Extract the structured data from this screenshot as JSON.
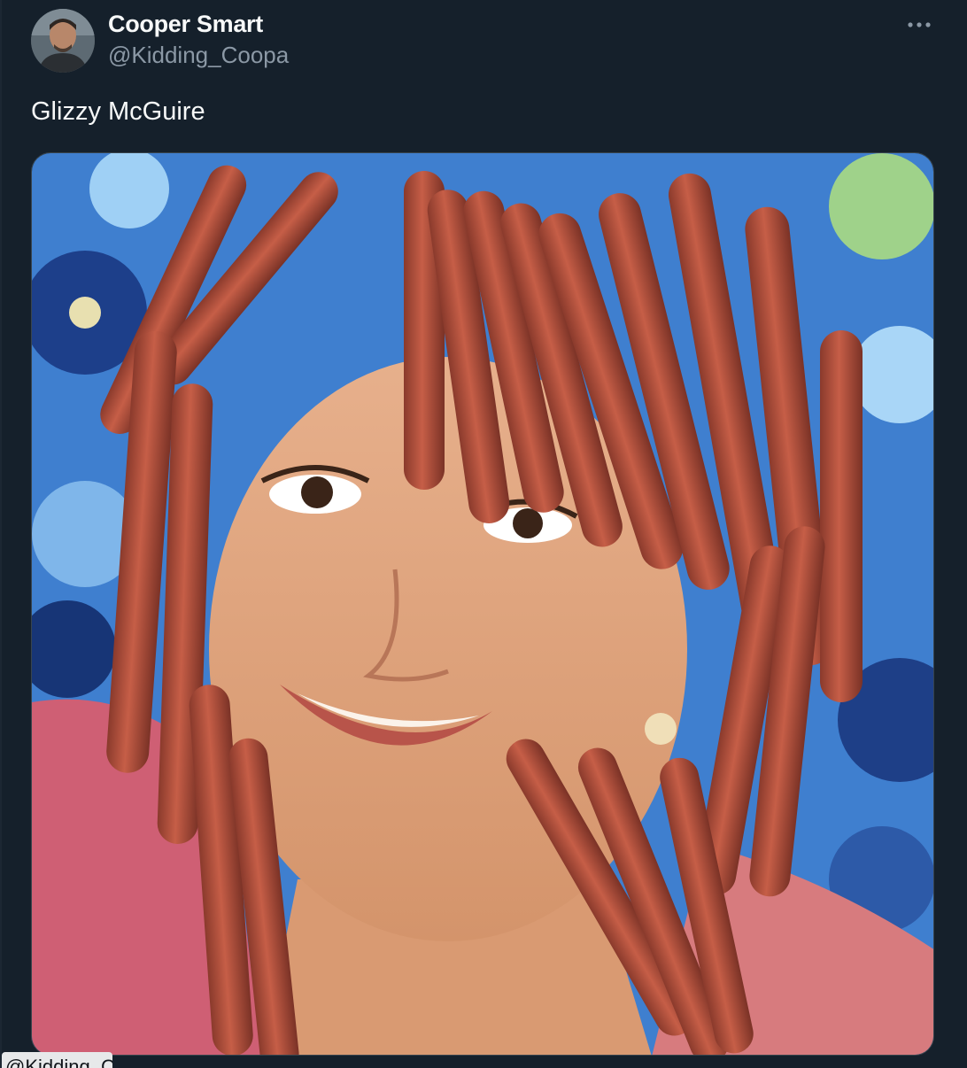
{
  "tweet": {
    "author": {
      "display_name": "Cooper Smart",
      "handle": "@Kidding_Coopa",
      "avatar_icon": "user-avatar-photo"
    },
    "text": "Glizzy McGuire",
    "more_icon": "more-horizontal-icon",
    "media": {
      "type": "image",
      "subject": "meme photo"
    }
  },
  "tooltip": {
    "text": "@Kidding_Coopa"
  },
  "colors": {
    "background": "#15202b",
    "primary_text": "#f7f9f9",
    "secondary_text": "#8b98a5",
    "border": "#38444d"
  }
}
